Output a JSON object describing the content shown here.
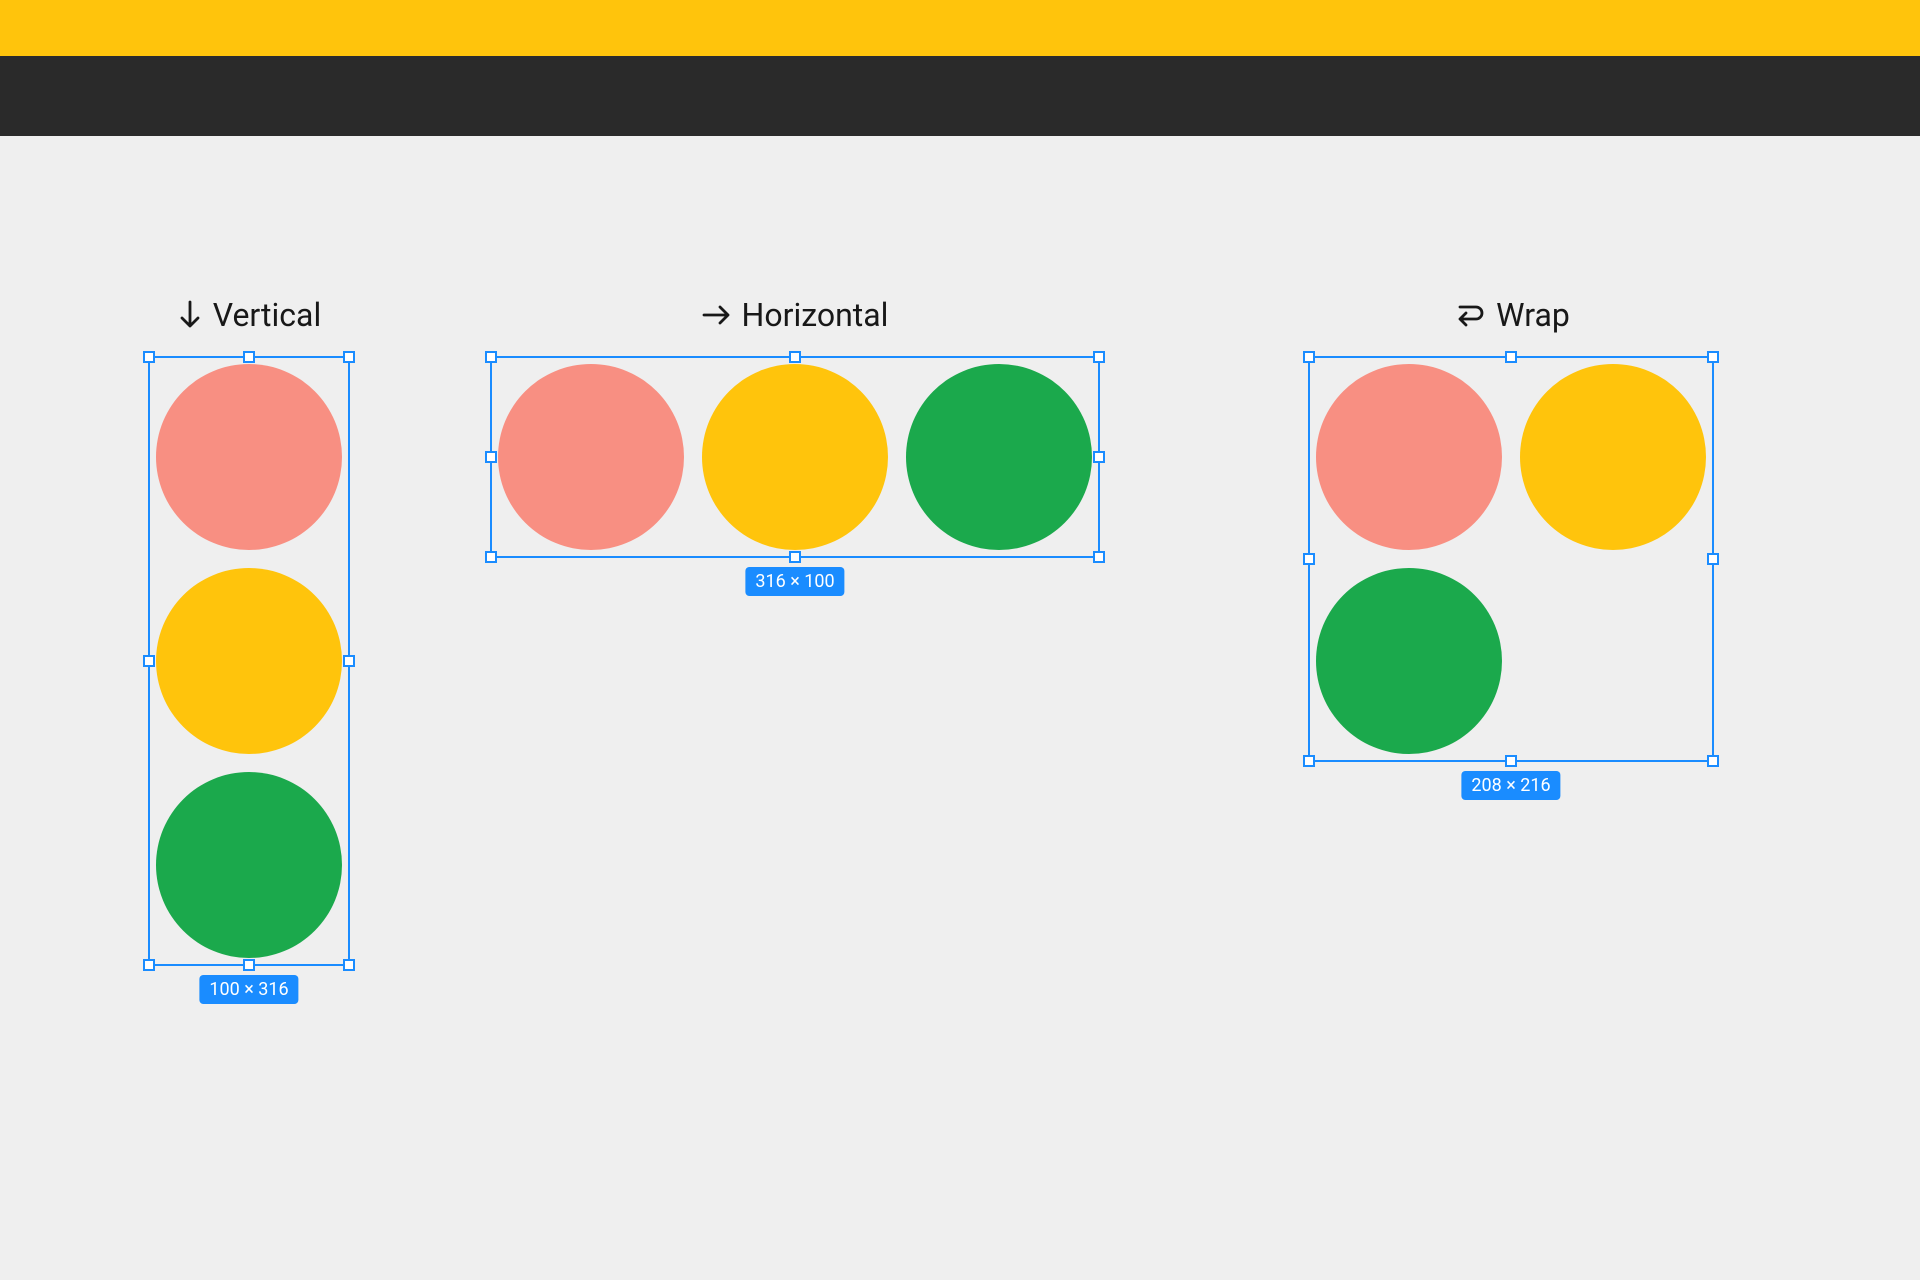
{
  "colors": {
    "yellow_bar": "#ffc40c",
    "dark_bar": "#2a2a2a",
    "canvas_bg": "#efefef",
    "selection": "#1a8cff",
    "circle_red": "#f88f82",
    "circle_yellow": "#ffc40c",
    "circle_green": "#1ba94c"
  },
  "examples": {
    "vertical": {
      "icon": "↓",
      "label": "Vertical",
      "dimensions": "100 × 316"
    },
    "horizontal": {
      "icon": "→",
      "label": "Horizontal",
      "dimensions": "316 × 100"
    },
    "wrap": {
      "icon": "↩",
      "label": "Wrap",
      "dimensions": "208 × 216"
    }
  }
}
